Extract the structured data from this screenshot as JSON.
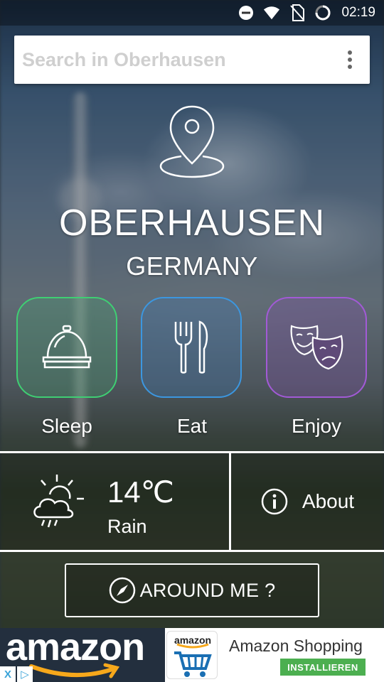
{
  "status_bar": {
    "time": "02:19",
    "icons": [
      "do-not-disturb-icon",
      "wifi-icon",
      "no-sim-icon",
      "loading-icon"
    ]
  },
  "search": {
    "placeholder": "Search in Oberhausen",
    "menu_icon": "more-vert-icon"
  },
  "hero": {
    "icon": "location-pin-icon",
    "city": "OBERHAUSEN",
    "country": "GERMANY"
  },
  "categories": [
    {
      "label": "Sleep",
      "icon": "service-bell-icon",
      "color": "#3fcf73"
    },
    {
      "label": "Eat",
      "icon": "fork-knife-icon",
      "color": "#3c97e0"
    },
    {
      "label": "Enjoy",
      "icon": "theater-masks-icon",
      "color": "#a25ad6"
    }
  ],
  "weather": {
    "icon": "sun-cloud-rain-icon",
    "temperature": "14℃",
    "condition": "Rain"
  },
  "about": {
    "icon": "info-icon",
    "label": "About"
  },
  "around_me": {
    "icon": "compass-icon",
    "label": "AROUND ME ?"
  },
  "ad": {
    "brand": "amazon",
    "app_icon_text": "amazon",
    "title": "Amazon Shopping",
    "cta": "INSTALLIEREN",
    "badges": [
      "X",
      "▷"
    ]
  }
}
